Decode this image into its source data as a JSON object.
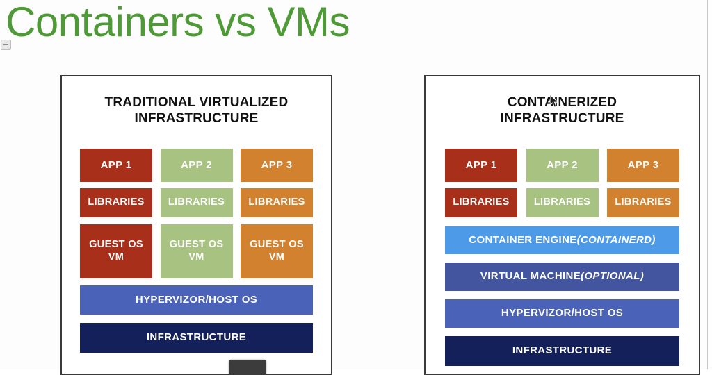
{
  "slide": {
    "title": "Containers vs VMs",
    "title_color": "#4e9a36"
  },
  "controls": {
    "plus_icon": "plus-icon",
    "cursor_icon": "mouse-cursor-arrow"
  },
  "colors": {
    "app_red": "#A8301A",
    "app_green": "#A8C281",
    "app_orange": "#D2812F",
    "hypervisor_blue": "#4A63B8",
    "container_engine_blue": "#4D9BE8",
    "vm_blue": "#42559E",
    "infrastructure_navy": "#14205A",
    "panel_border": "#3a3a3a"
  },
  "panels": [
    {
      "id": "traditional",
      "heading": "TRADITIONAL VIRTUALIZED\nINFRASTRUCTURE",
      "rows": {
        "apps": [
          "APP 1",
          "APP 2",
          "APP 3"
        ],
        "libraries": [
          "LIBRARIES",
          "LIBRARIES",
          "LIBRARIES"
        ],
        "guest_os": [
          "GUEST OS\nVM",
          "GUEST OS\nVM",
          "GUEST OS\nVM"
        ],
        "hypervisor": "HYPERVIZOR/HOST OS",
        "infrastructure": "INFRASTRUCTURE"
      }
    },
    {
      "id": "containerized",
      "heading": "CONTAINERIZED\nINFRASTRUCTURE",
      "rows": {
        "apps": [
          "APP 1",
          "APP 2",
          "APP 3"
        ],
        "libraries": [
          "LIBRARIES",
          "LIBRARIES",
          "LIBRARIES"
        ],
        "container_engine_main": "CONTAINER ENGINE ",
        "container_engine_italic": "(CONTAINERD)",
        "virtual_machine_main": "VIRTUAL MACHINE ",
        "virtual_machine_italic": "(OPTIONAL)",
        "hypervisor": "HYPERVIZOR/HOST OS",
        "infrastructure": "INFRASTRUCTURE"
      }
    }
  ]
}
